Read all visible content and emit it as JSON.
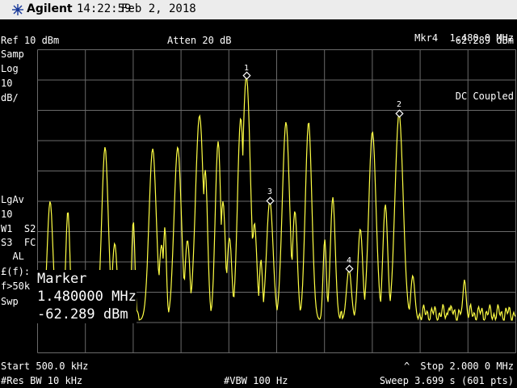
{
  "title_bar": {
    "brand": "Agilent",
    "time": "14:22:59",
    "date": "Feb 2, 2018",
    "logo_icon": "agilent-spark-icon"
  },
  "header": {
    "marker_readout_label": "Mkr4",
    "marker_readout_freq": "1.480 0 MHz",
    "marker_readout_level": "-62.289 dBm",
    "ref_level": "Ref 10 dBm",
    "attenuation": "Atten 20 dB"
  },
  "left_panel": {
    "detector": "Samp",
    "scale_type": "Log",
    "scale_value": "10",
    "scale_unit": "dB/",
    "avg_type": "LgAv",
    "avg_count": "10",
    "trace_line1": "W1  S2",
    "trace_line2": "S3  FC",
    "trace_line3": "  AL",
    "corr_line1": "£(f):",
    "corr_line2": "f>50k",
    "sweep_label": "Swp"
  },
  "coupling": "DC Coupled",
  "marker_box": {
    "title": "Marker",
    "freq": "1.480000 MHz",
    "level": "-62.289 dBm"
  },
  "footer": {
    "start_freq": "Start 500.0 kHz",
    "stop_freq": "Stop 2.000 0 MHz",
    "stop_caret": "^",
    "res_bw": "#Res BW 10 kHz",
    "vbw": "#VBW 100 Hz",
    "sweep": "Sweep 3.699 s (601 pts)"
  },
  "markers": [
    {
      "label": "1"
    },
    {
      "label": "2"
    },
    {
      "label": "3"
    },
    {
      "label": "4"
    }
  ],
  "colors": {
    "trace": "#ffff44",
    "graticule": "#6a6a6a",
    "background": "#000000",
    "title_bar": "#ececec"
  }
}
